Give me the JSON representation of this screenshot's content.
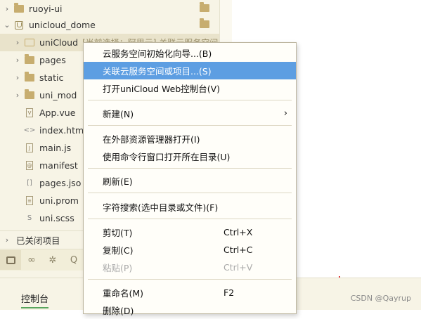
{
  "tree": {
    "rows": [
      {
        "label": "ruoyi-ui",
        "icon": "folder-icon",
        "arrow": "›"
      },
      {
        "label": "unicloud_dome",
        "icon": "project-icon",
        "arrow": "⌄"
      },
      {
        "label": "uniCloud",
        "hint": "[当前选择：阿里云] 关联云服务空间",
        "icon": "folder-open-icon",
        "arrow": "›"
      },
      {
        "label": "pages",
        "icon": "folder-icon",
        "arrow": "›"
      },
      {
        "label": "static",
        "icon": "folder-icon",
        "arrow": "›"
      },
      {
        "label": "uni_mod",
        "icon": "folder-icon",
        "arrow": "›"
      },
      {
        "label": "App.vue",
        "icon": "vue-file-icon",
        "glyph": "V"
      },
      {
        "label": "index.htm",
        "icon": "html-file-icon",
        "glyph": "<>"
      },
      {
        "label": "main.js",
        "icon": "js-file-icon",
        "glyph": "J"
      },
      {
        "label": "manifest",
        "icon": "json-file-icon",
        "glyph": "@"
      },
      {
        "label": "pages.jso",
        "icon": "json-file-icon",
        "glyph": "[]"
      },
      {
        "label": "uni.prom",
        "icon": "file-icon",
        "glyph": "≡"
      },
      {
        "label": "uni.scss",
        "icon": "scss-file-icon",
        "glyph": "S"
      }
    ],
    "closed_projects": "已关闭项目"
  },
  "context_menu": {
    "items": [
      {
        "label": "云服务空间初始化向导...(B)"
      },
      {
        "label": "关联云服务空间或项目...(S)",
        "highlighted": true
      },
      {
        "label": "打开uniCloud Web控制台(V)"
      },
      {
        "label": "新建(N)",
        "submenu": "›"
      },
      {
        "label": "在外部资源管理器打开(I)"
      },
      {
        "label": "使用命令行窗口打开所在目录(U)"
      },
      {
        "label": "刷新(E)"
      },
      {
        "label": "字符搜索(选中目录或文件)(F)"
      },
      {
        "label": "剪切(T)",
        "shortcut": "Ctrl+X"
      },
      {
        "label": "复制(C)",
        "shortcut": "Ctrl+C"
      },
      {
        "label": "粘贴(P)",
        "shortcut": "Ctrl+V",
        "disabled": true
      },
      {
        "label": "重命名(M)",
        "shortcut": "F2"
      },
      {
        "label": "删除(D)"
      }
    ]
  },
  "bottom": {
    "console_tab": "控制台",
    "watermark": "CSDN @Qayrup"
  },
  "colors": {
    "sidebar_bg": "#f7f4e6",
    "menu_highlight": "#5d9ee2",
    "active_tab_underline": "#58a55c"
  }
}
